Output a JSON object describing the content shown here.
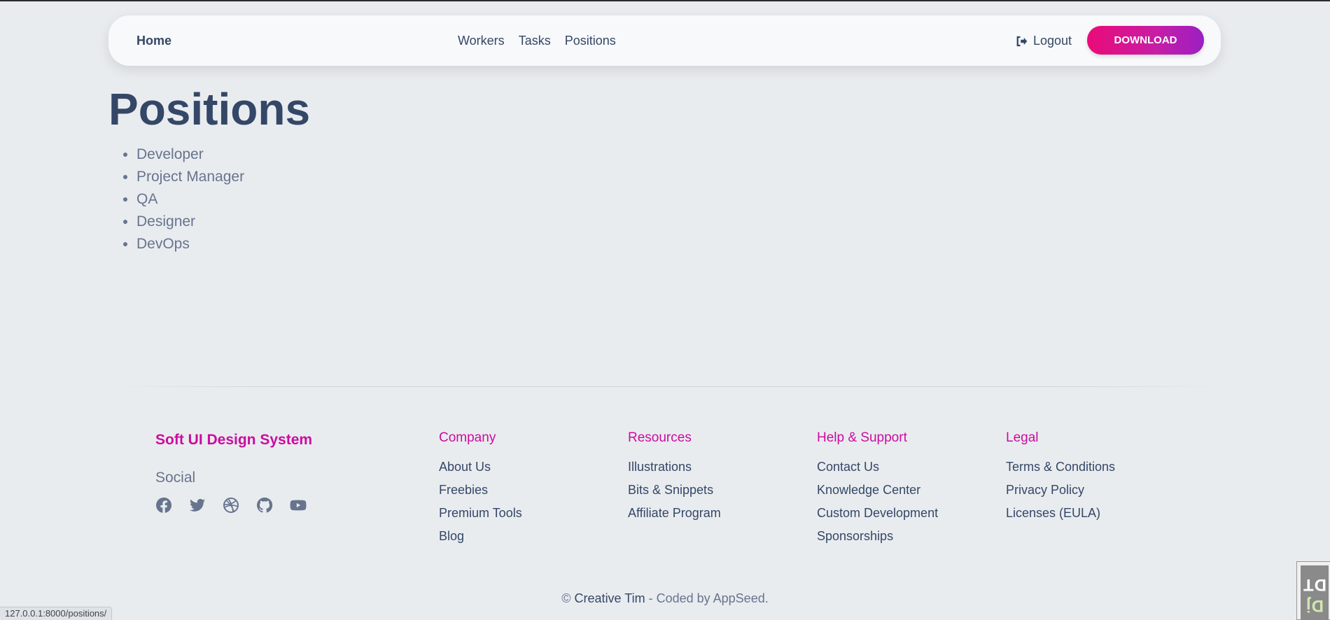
{
  "navbar": {
    "brand": "Home",
    "links": [
      "Workers",
      "Tasks",
      "Positions"
    ],
    "logout_label": "Logout",
    "download_label": "DOWNLOAD"
  },
  "main": {
    "title": "Positions",
    "positions": [
      "Developer",
      "Project Manager",
      "QA",
      "Designer",
      "DevOps"
    ]
  },
  "footer": {
    "brand": "Soft UI Design System",
    "social_title": "Social",
    "social_icons": [
      "facebook-icon",
      "twitter-icon",
      "dribbble-icon",
      "github-icon",
      "youtube-icon"
    ],
    "columns": [
      {
        "title": "Company",
        "links": [
          "About Us",
          "Freebies",
          "Premium Tools",
          "Blog"
        ]
      },
      {
        "title": "Resources",
        "links": [
          "Illustrations",
          "Bits & Snippets",
          "Affiliate Program"
        ]
      },
      {
        "title": "Help & Support",
        "links": [
          "Contact Us",
          "Knowledge Center",
          "Custom Development",
          "Sponsorships"
        ]
      },
      {
        "title": "Legal",
        "links": [
          "Terms & Conditions",
          "Privacy Policy",
          "Licenses (EULA)"
        ]
      }
    ],
    "copyright_prefix": "©",
    "copyright_author": "Creative Tim",
    "copyright_suffix": "- Coded by AppSeed."
  },
  "statusbar": {
    "url": "127.0.0.1:8000/positions/"
  },
  "debug_toolbar": {
    "label_dj": "Dj",
    "label_dt": "DT"
  },
  "colors": {
    "accent": "#cb0c9f",
    "text": "#344767",
    "muted": "#67748e",
    "background": "#e9ecef"
  }
}
